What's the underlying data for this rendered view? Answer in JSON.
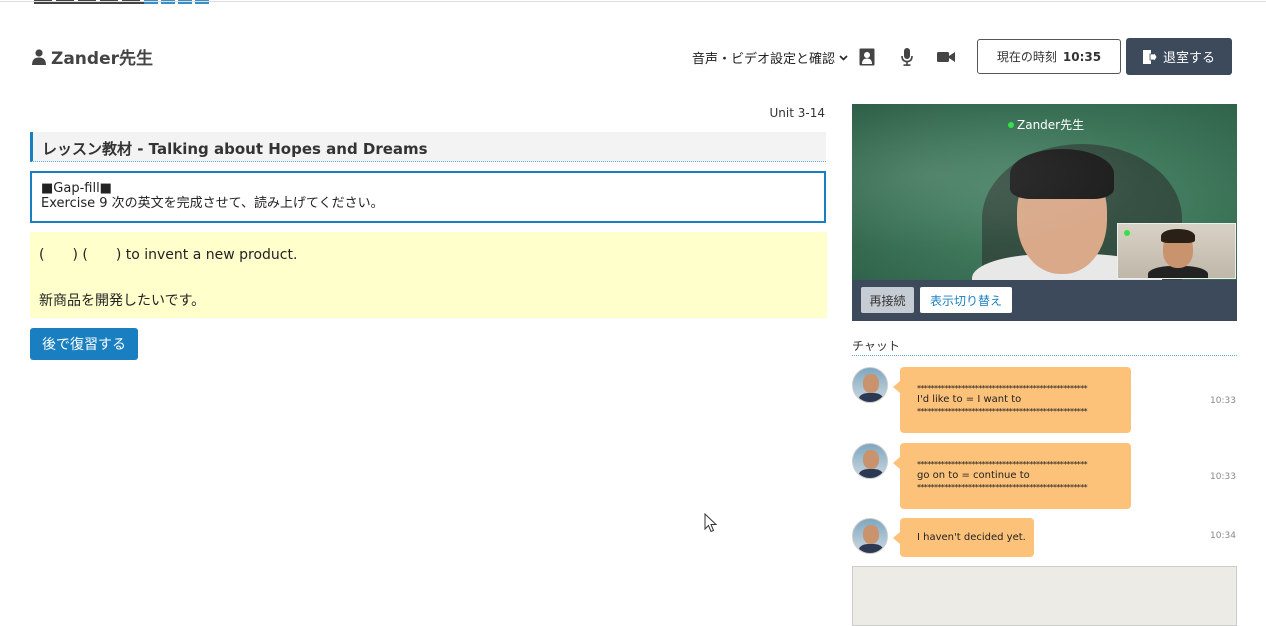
{
  "header": {
    "teacher_name": "Zander先生",
    "av_settings": "音声・ビデオ設定と確認",
    "clock_label": "現在の時刻",
    "clock_time": "10:35",
    "exit_label": "退室する"
  },
  "lesson": {
    "unit": "Unit 3-14",
    "title": "レッスン教材 - Talking about Hopes and Dreams",
    "exercise_tag": "■Gap-fill■",
    "exercise_instruction": "Exercise 9 次の英文を完成させて、読み上げてください。",
    "sentence_en": "(　　) (　　) to invent a new product.",
    "sentence_ja": "新商品を開発したいです。",
    "review_button": "後で復習する"
  },
  "video": {
    "teacher_label": "Zander先生",
    "reconnect_button": "再接続",
    "switch_view_button": "表示切り替え"
  },
  "chat": {
    "label": "チャット",
    "messages": [
      {
        "stars_top": "**************************************************",
        "text": "I'd like to = I want to",
        "stars_bottom": "**************************************************",
        "time": "10:33"
      },
      {
        "stars_top": "**************************************************",
        "text": "go on to = continue to",
        "stars_bottom": "**************************************************",
        "time": "10:33"
      },
      {
        "text": "I haven't decided yet.",
        "time": "10:34"
      }
    ]
  },
  "colors": {
    "accent_blue": "#1a7fc0",
    "dark_button": "#3c4a5c",
    "chat_bubble": "#fcc27a",
    "sentence_bg": "#ffffcc",
    "online_dot": "#35e04a"
  }
}
